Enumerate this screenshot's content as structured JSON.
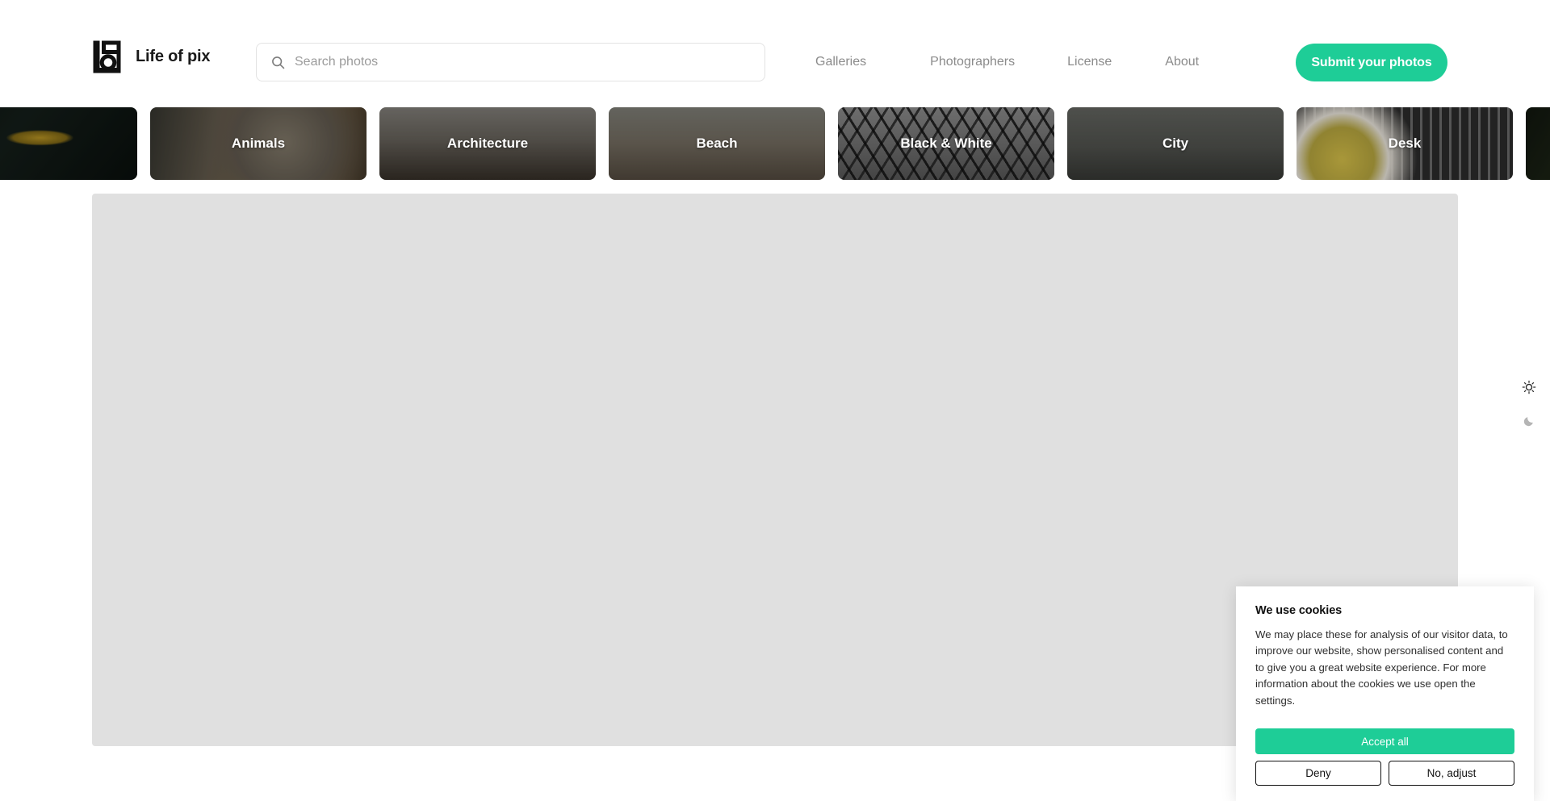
{
  "header": {
    "brand_name": "Life of pix",
    "logo_icon": "camera-logo-icon",
    "search": {
      "placeholder": "Search photos",
      "value": "",
      "icon": "search-icon"
    },
    "nav": [
      {
        "label": "Galleries"
      },
      {
        "label": "Photographers"
      },
      {
        "label": "License"
      },
      {
        "label": "About"
      }
    ],
    "cta_label": "Submit your photos",
    "cta_color": "#1ecd97"
  },
  "categories": [
    {
      "label": "",
      "style": "bg-car",
      "partial": true
    },
    {
      "label": "Animals",
      "style": "bg-animals"
    },
    {
      "label": "Architecture",
      "style": "bg-architecture"
    },
    {
      "label": "Beach",
      "style": "bg-beach"
    },
    {
      "label": "Black & White",
      "style": "bg-bw"
    },
    {
      "label": "City",
      "style": "bg-city"
    },
    {
      "label": "Desk",
      "style": "bg-desk"
    },
    {
      "label": "",
      "style": "bg-flower",
      "partial": true
    }
  ],
  "main": {
    "state": "loading-placeholder"
  },
  "theme_toggle": {
    "light_icon": "sun-icon",
    "dark_icon": "moon-icon",
    "active": "light"
  },
  "cookie_dialog": {
    "title": "We use cookies",
    "body": "We may place these for analysis of our visitor data, to improve our website, show personalised content and to give you a great website experience. For more information about the cookies we use open the settings.",
    "accept_label": "Accept all",
    "deny_label": "Deny",
    "adjust_label": "No, adjust",
    "accent_color": "#1ecd97"
  }
}
